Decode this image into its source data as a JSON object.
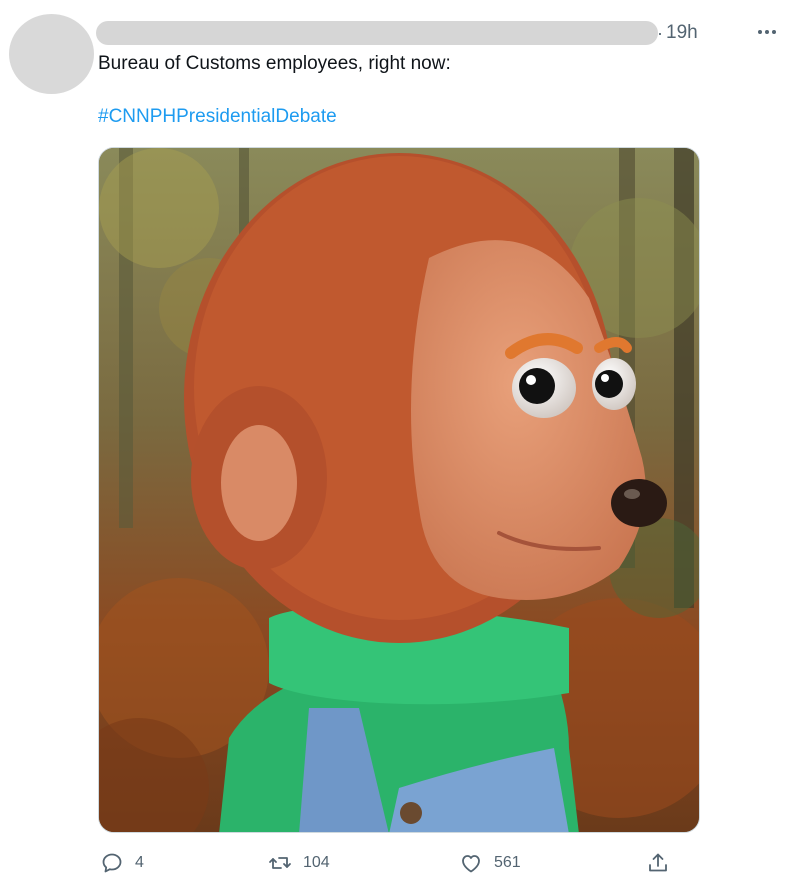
{
  "tweet": {
    "time_separator": "·",
    "time": "19h",
    "text": "Bureau of Customs employees, right now:",
    "hashtag": "#CNNPHPresidentialDebate"
  },
  "actions": {
    "reply_count": "4",
    "retweet_count": "104",
    "like_count": "561"
  },
  "icons": {
    "more": "more-options-icon",
    "reply": "reply-icon",
    "retweet": "retweet-icon",
    "like": "heart-icon",
    "share": "share-icon"
  },
  "colors": {
    "link": "#1d9bf0",
    "secondary_text": "#536471",
    "primary_text": "#0f1419"
  }
}
